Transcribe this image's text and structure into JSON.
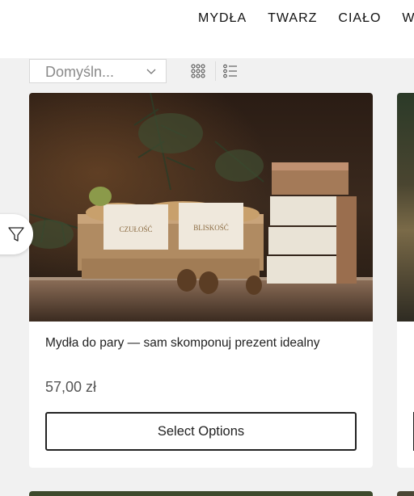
{
  "nav": {
    "items": [
      "MYDŁA",
      "TWARZ",
      "CIAŁO",
      "W"
    ]
  },
  "toolbar": {
    "sort_value": "Domyśln...",
    "grid_icon": "grid-view-icon",
    "list_icon": "list-view-icon"
  },
  "filter": {
    "icon": "filter-icon"
  },
  "product": {
    "title": "Mydła do pary — sam skomponuj prezent idealny",
    "price": "57,00 zł",
    "button_label": "Select Options",
    "image_labels": [
      "CZUŁOŚĆ",
      "BLISKOŚĆ"
    ]
  },
  "colors": {
    "button_border": "#222222",
    "background": "#f1f1f1"
  }
}
